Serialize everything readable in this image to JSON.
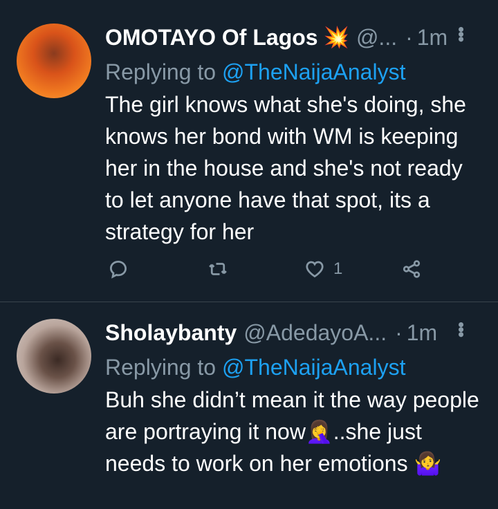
{
  "tweets": [
    {
      "name": "OMOTAYO Of Lagos",
      "name_emoji": "💥",
      "handle": "@...",
      "separator": "·",
      "time": "1m",
      "replying_prefix": "Replying to",
      "replying_to": "@TheNaijaAnalyst",
      "text": "The girl knows what she's doing, she knows her bond with WM is keeping her in the house and she's not ready to let anyone have that spot, its a strategy for her",
      "like_count": "1"
    },
    {
      "name": "Sholaybanty",
      "handle": "@AdedayoA...",
      "separator": "·",
      "time": "1m",
      "replying_prefix": "Replying to",
      "replying_to": "@TheNaijaAnalyst",
      "text": "Buh she didn’t mean it the way people are portraying it now🤦‍♀️..she just needs to work on her emotions 🤷‍♀️"
    }
  ],
  "icons": {
    "reply": "reply-icon",
    "retweet": "retweet-icon",
    "like": "heart-icon",
    "share": "share-icon",
    "more": "more-icon"
  },
  "colors": {
    "background": "#15202b",
    "secondary_text": "#8899a6",
    "link": "#1da1f2",
    "divider": "#38444d"
  }
}
